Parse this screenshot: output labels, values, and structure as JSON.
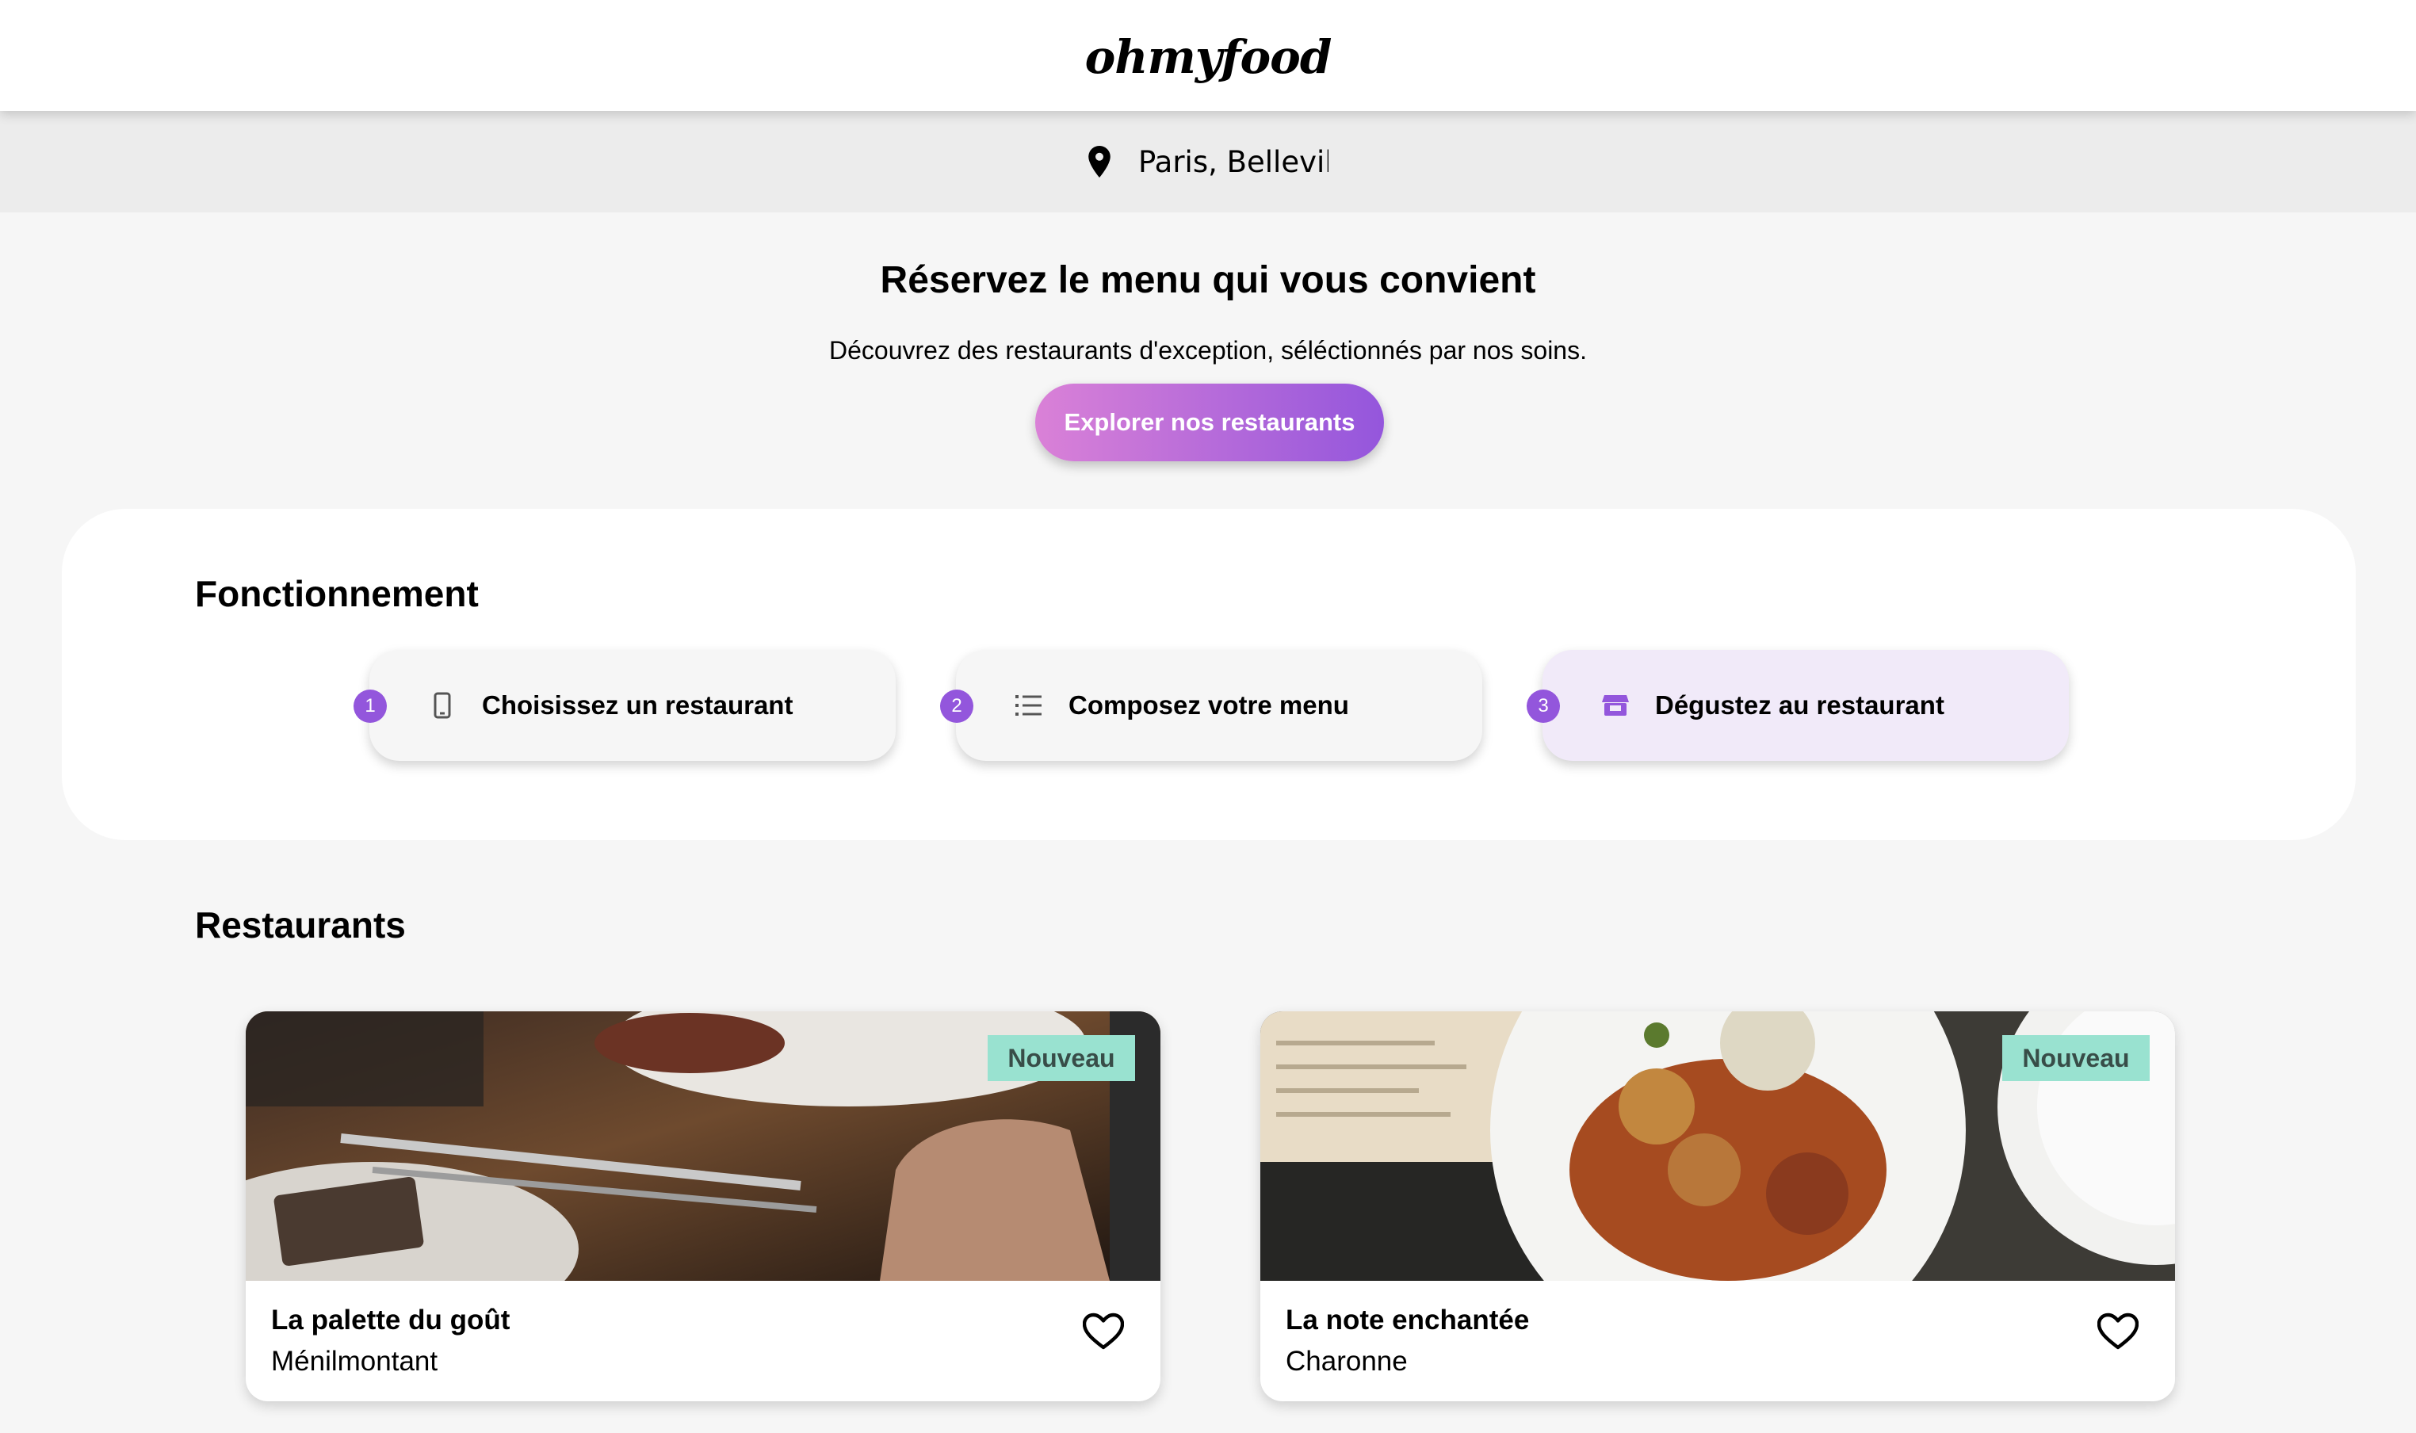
{
  "header": {
    "logo": "ohmyfood"
  },
  "location": {
    "text": "Paris, Belleville",
    "icon": "map-pin-icon"
  },
  "hero": {
    "title": "Réservez le menu qui vous convient",
    "subtitle": "Découvrez des restaurants d'exception, séléctionnés par nos soins.",
    "cta_label": "Explorer nos restaurants"
  },
  "how": {
    "title": "Fonctionnement",
    "steps": [
      {
        "number": "1",
        "label": "Choisissez un restaurant",
        "icon": "smartphone-icon"
      },
      {
        "number": "2",
        "label": "Composez votre menu",
        "icon": "list-icon"
      },
      {
        "number": "3",
        "label": "Dégustez au restaurant",
        "icon": "store-icon"
      }
    ]
  },
  "restaurants": {
    "title": "Restaurants",
    "cards": [
      {
        "name": "La palette du goût",
        "area": "Ménilmontant",
        "badge": "Nouveau"
      },
      {
        "name": "La note enchantée",
        "area": "Charonne",
        "badge": "Nouveau"
      }
    ]
  },
  "colors": {
    "accent_purple": "#9356dc",
    "accent_pink": "#da81d7",
    "badge_green": "#99e2d0",
    "background": "#f6f6f6"
  }
}
